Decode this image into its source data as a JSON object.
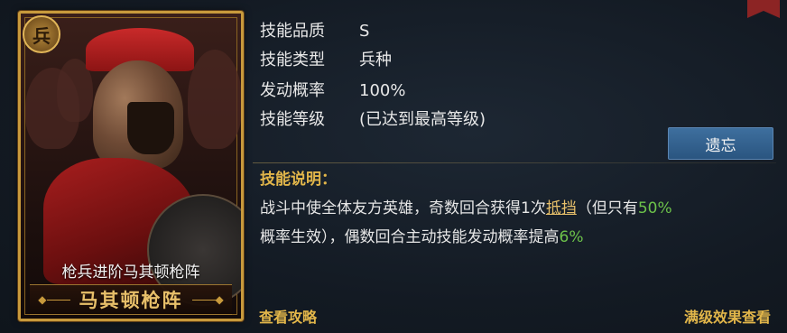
{
  "card": {
    "badge": "兵",
    "subtitle": "枪兵进阶马其顿枪阵",
    "title": "马其顿枪阵"
  },
  "info": [
    {
      "label": "技能品质",
      "value": "S"
    },
    {
      "label": "技能类型",
      "value": "兵种"
    },
    {
      "label": "发动概率",
      "value": "100%"
    },
    {
      "label": "技能等级",
      "value": "(已达到最高等级)"
    }
  ],
  "forget_button": "遗忘",
  "description": {
    "title": "技能说明：",
    "part1": "战斗中使全体友方英雄，奇数回合获得1次",
    "keyword": "抵挡",
    "part2": "（但只有",
    "pct1": "50%",
    "part3": "概率生效），偶数回合主动技能发动概率提高",
    "pct2": "6%"
  },
  "links": {
    "guide": "查看攻略",
    "max_effect": "满级效果查看"
  },
  "colors": {
    "gold": "#e2b64a",
    "green": "#6cc24a",
    "button_blue": "#2f5f8e"
  }
}
